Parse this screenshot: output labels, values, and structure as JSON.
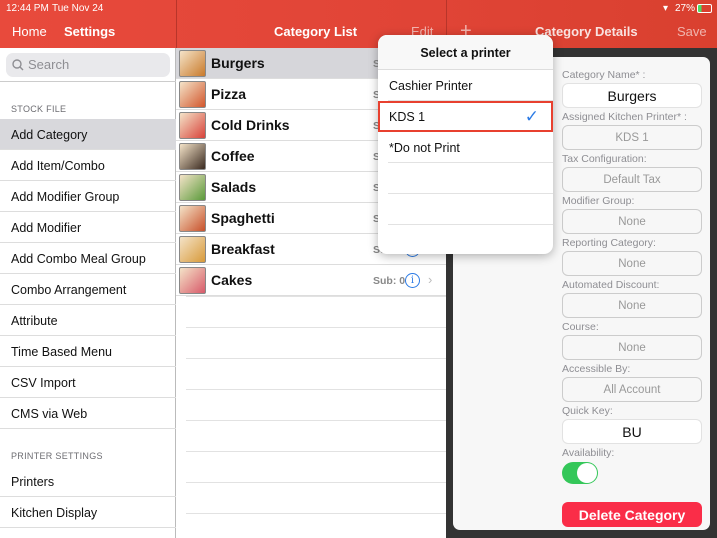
{
  "status": {
    "time": "12:44 PM",
    "date": "Tue Nov 24",
    "battery": "27%"
  },
  "nav": {
    "home": "Home",
    "settings": "Settings",
    "category_list": "Category List",
    "edit": "Edit",
    "add": "+",
    "category_details": "Category Details",
    "save": "Save"
  },
  "sidebar": {
    "search_placeholder": "Search",
    "stock_header": "STOCK FILE",
    "stock_items": [
      "Add Category",
      "Add Item/Combo",
      "Add Modifier Group",
      "Add Modifier",
      "Add Combo Meal Group",
      "Combo Arrangement",
      "Attribute",
      "Time Based Menu",
      "CSV Import",
      "CMS via Web"
    ],
    "printer_header": "PRINTER SETTINGS",
    "printer_items": [
      "Printers",
      "Kitchen Display"
    ],
    "selected": "Add Category"
  },
  "categories": [
    {
      "name": "Burgers",
      "sub": "Sub: 0",
      "color": "#c97a2a"
    },
    {
      "name": "Pizza",
      "sub": "Sub: 0",
      "color": "#d2562c"
    },
    {
      "name": "Cold Drinks",
      "sub": "Sub: 0",
      "color": "#d8423a"
    },
    {
      "name": "Coffee",
      "sub": "Sub: 0",
      "color": "#3a2a20"
    },
    {
      "name": "Salads",
      "sub": "Sub: 0",
      "color": "#5a9a3a"
    },
    {
      "name": "Spaghetti",
      "sub": "Sub: 0",
      "color": "#c8502a"
    },
    {
      "name": "Breakfast",
      "sub": "Sub: 0",
      "color": "#d89a3a"
    },
    {
      "name": "Cakes",
      "sub": "Sub: 0",
      "color": "#d85a6a"
    }
  ],
  "popover": {
    "title": "Select a printer",
    "options": [
      "Cashier Printer",
      "KDS 1",
      "*Do not Print"
    ],
    "selected": "KDS 1"
  },
  "details": {
    "fields": [
      {
        "label": "Category Name* :",
        "value": "Burgers",
        "editable": true
      },
      {
        "label": "Assigned Kitchen Printer* :",
        "value": "KDS 1"
      },
      {
        "label": "Tax Configuration:",
        "value": "Default Tax"
      },
      {
        "label": "Modifier Group:",
        "value": "None"
      },
      {
        "label": "Reporting Category:",
        "value": "None"
      },
      {
        "label": "Automated Discount:",
        "value": "None"
      },
      {
        "label": "Course:",
        "value": "None"
      },
      {
        "label": "Accessible By:",
        "value": "All Account"
      },
      {
        "label": "Quick Key:",
        "value": "BU",
        "editable": true
      }
    ],
    "availability_label": "Availability:",
    "availability": true,
    "delete": "Delete Category"
  },
  "colors": {
    "accent": "#e84a3c",
    "delete": "#fa2d48",
    "toggle": "#34c759",
    "check": "#2c7be5"
  }
}
